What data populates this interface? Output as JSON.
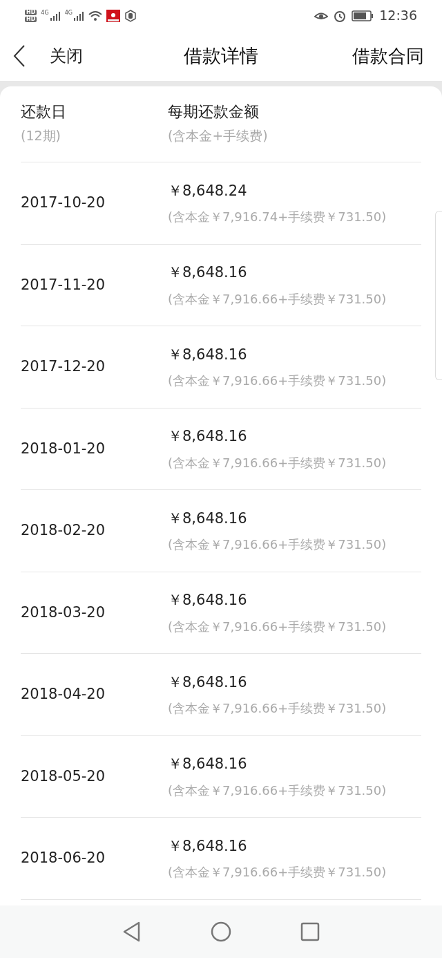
{
  "status_bar": {
    "sim_labels": [
      "HD",
      "HD"
    ],
    "network_labels": [
      "4G",
      "4G"
    ],
    "time": "12:36"
  },
  "header": {
    "back_label": "关闭",
    "title": "借款详情",
    "action": "借款合同"
  },
  "table": {
    "columns": [
      {
        "title": "还款日",
        "subtitle": "(12期)"
      },
      {
        "title": "每期还款金额",
        "subtitle": "(含本金+手续费)"
      }
    ],
    "rows": [
      {
        "date": "2017-10-20",
        "amount": "￥8,648.24",
        "breakdown": "(含本金￥7,916.74+手续费￥731.50)"
      },
      {
        "date": "2017-11-20",
        "amount": "￥8,648.16",
        "breakdown": "(含本金￥7,916.66+手续费￥731.50)"
      },
      {
        "date": "2017-12-20",
        "amount": "￥8,648.16",
        "breakdown": "(含本金￥7,916.66+手续费￥731.50)"
      },
      {
        "date": "2018-01-20",
        "amount": "￥8,648.16",
        "breakdown": "(含本金￥7,916.66+手续费￥731.50)"
      },
      {
        "date": "2018-02-20",
        "amount": "￥8,648.16",
        "breakdown": "(含本金￥7,916.66+手续费￥731.50)"
      },
      {
        "date": "2018-03-20",
        "amount": "￥8,648.16",
        "breakdown": "(含本金￥7,916.66+手续费￥731.50)"
      },
      {
        "date": "2018-04-20",
        "amount": "￥8,648.16",
        "breakdown": "(含本金￥7,916.66+手续费￥731.50)"
      },
      {
        "date": "2018-05-20",
        "amount": "￥8,648.16",
        "breakdown": "(含本金￥7,916.66+手续费￥731.50)"
      },
      {
        "date": "2018-06-20",
        "amount": "￥8,648.16",
        "breakdown": "(含本金￥7,916.66+手续费￥731.50)"
      }
    ]
  }
}
